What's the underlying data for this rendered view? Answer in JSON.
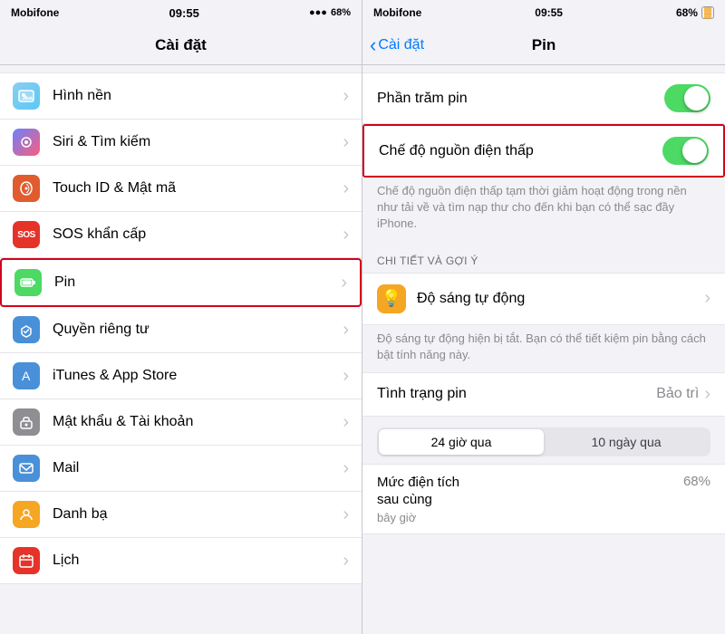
{
  "left": {
    "status": {
      "carrier": "Mobifone",
      "time": "09:55",
      "battery": "68%",
      "battery_icon": "🔋"
    },
    "nav": {
      "title": "Cài đặt"
    },
    "items": [
      {
        "id": "wallpaper",
        "label": "Hình nền",
        "icon_class": "icon-wallpaper",
        "icon": "🖼"
      },
      {
        "id": "siri",
        "label": "Siri & Tìm kiếm",
        "icon_class": "icon-siri",
        "icon": "✦"
      },
      {
        "id": "touchid",
        "label": "Touch ID & Mật mã",
        "icon_class": "icon-touchid",
        "icon": "👆"
      },
      {
        "id": "sos",
        "label": "SOS khẩn cấp",
        "icon_class": "icon-sos",
        "icon": "SOS"
      },
      {
        "id": "battery",
        "label": "Pin",
        "icon_class": "icon-battery",
        "icon": "🔋",
        "highlighted": true
      },
      {
        "id": "privacy",
        "label": "Quyền riêng tư",
        "icon_class": "icon-privacy",
        "icon": "✋"
      },
      {
        "id": "itunes",
        "label": "iTunes & App Store",
        "icon_class": "icon-itunes",
        "icon": "A"
      },
      {
        "id": "password",
        "label": "Mật khẩu & Tài khoản",
        "icon_class": "icon-password",
        "icon": "🔑"
      },
      {
        "id": "mail",
        "label": "Mail",
        "icon_class": "icon-mail",
        "icon": "✉"
      },
      {
        "id": "contacts",
        "label": "Danh bạ",
        "icon_class": "icon-contacts",
        "icon": "👤"
      },
      {
        "id": "calendar",
        "label": "Lịch",
        "icon_class": "icon-calendar",
        "icon": "📅"
      }
    ]
  },
  "right": {
    "status": {
      "carrier": "Mobifone",
      "time": "09:55",
      "battery": "68%"
    },
    "nav": {
      "back_label": "Cài đặt",
      "title": "Pin"
    },
    "items": [
      {
        "id": "phantrampin",
        "label": "Phần trăm pin",
        "toggle": "on"
      },
      {
        "id": "chedonguon",
        "label": "Chế độ nguồn điện thấp",
        "toggle": "on",
        "highlighted": true
      }
    ],
    "description": "Chế độ nguồn điện thấp tạm thời giảm hoạt động trong nền như tải về và tìm nạp thư cho đến khi bạn có thể sạc đầy iPhone.",
    "detail_section_title": "CHI TIẾT VÀ GỢI Ý",
    "brightness": {
      "label": "Độ sáng tự động",
      "description": "Độ sáng tự động hiện bị tắt. Bạn có thể tiết kiệm pin bằng cách bật tính năng này."
    },
    "tinh_trang": {
      "label": "Tình trạng pin",
      "value": "Bảo trì"
    },
    "time_tabs": [
      {
        "label": "24 giờ qua",
        "active": true
      },
      {
        "label": "10 ngày qua",
        "active": false
      }
    ],
    "muc_dien_tich": {
      "title_line1": "Mức điện tích",
      "title_line2": "sau cùng",
      "sub": "bây giờ",
      "value": "68%"
    }
  }
}
